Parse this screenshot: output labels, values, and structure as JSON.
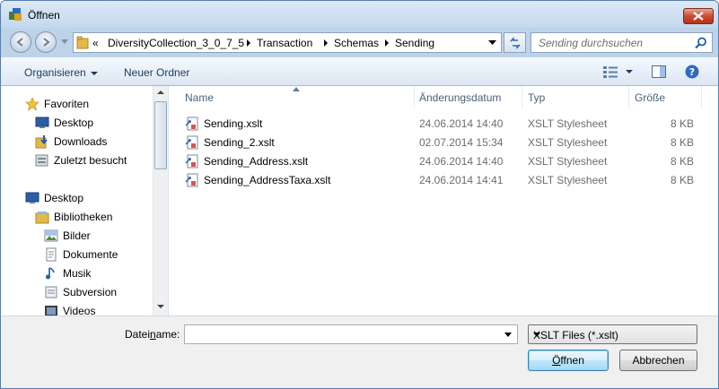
{
  "window": {
    "title": "Öffnen"
  },
  "address": {
    "overflow_label": "«",
    "crumbs": [
      "DiversityCollection_3_0_7_5",
      "Transaction",
      "Schemas",
      "Sending"
    ]
  },
  "search": {
    "placeholder": "Sending durchsuchen"
  },
  "toolbar": {
    "organize_label": "Organisieren",
    "new_folder_label": "Neuer Ordner"
  },
  "navpane": {
    "favorites": {
      "label": "Favoriten",
      "icon": "star-icon"
    },
    "favorite_items": [
      {
        "label": "Desktop",
        "icon": "desktop-icon"
      },
      {
        "label": "Downloads",
        "icon": "downloads-icon"
      },
      {
        "label": "Zuletzt besucht",
        "icon": "recent-places-icon"
      }
    ],
    "desktop": {
      "label": "Desktop",
      "icon": "desktop-icon"
    },
    "libraries": {
      "label": "Bibliotheken",
      "icon": "libraries-icon"
    },
    "library_items": [
      {
        "label": "Bilder",
        "icon": "pictures-icon"
      },
      {
        "label": "Dokumente",
        "icon": "documents-icon"
      },
      {
        "label": "Musik",
        "icon": "music-icon"
      },
      {
        "label": "Subversion",
        "icon": "subversion-icon"
      },
      {
        "label": "Videos",
        "icon": "videos-icon"
      }
    ]
  },
  "filelist": {
    "columns": {
      "name": "Name",
      "date": "Änderungsdatum",
      "type": "Typ",
      "size": "Größe"
    },
    "rows": [
      {
        "name": "Sending.xslt",
        "date": "24.06.2014 14:40",
        "type": "XSLT Stylesheet",
        "size": "8 KB"
      },
      {
        "name": "Sending_2.xslt",
        "date": "02.07.2014 15:34",
        "type": "XSLT Stylesheet",
        "size": "8 KB"
      },
      {
        "name": "Sending_Address.xslt",
        "date": "24.06.2014 14:40",
        "type": "XSLT Stylesheet",
        "size": "8 KB"
      },
      {
        "name": "Sending_AddressTaxa.xslt",
        "date": "24.06.2014 14:41",
        "type": "XSLT Stylesheet",
        "size": "8 KB"
      }
    ]
  },
  "footer": {
    "filename_label_pre": "Datei",
    "filename_label_u": "n",
    "filename_label_post": "ame:",
    "filename_value": "",
    "filter_value": "XSLT Files (*.xslt)",
    "open_label_u": "Ö",
    "open_label_rest": "ffnen",
    "cancel_label": "Abbrechen"
  }
}
